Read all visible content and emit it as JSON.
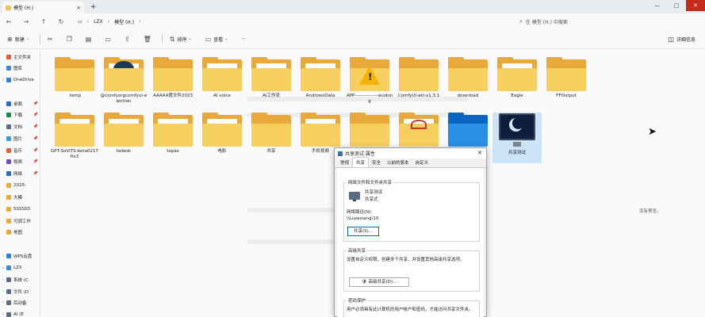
{
  "window": {
    "tab_title": "模型 (H:)",
    "tab_close": "×",
    "new_tab": "+",
    "minimize": "—",
    "maximize": "□",
    "close": "✕"
  },
  "nav": {
    "back": "←",
    "forward": "→",
    "up": "↑",
    "refresh": "↻",
    "breadcrumbs": [
      "LZX",
      "模型 (H:)"
    ],
    "search_placeholder": "在 模型 (H:) 中搜索"
  },
  "toolbar": {
    "new_label": "新建",
    "sort_label": "排序",
    "view_label": "查看",
    "more_label": "···",
    "details_label": "详细信息"
  },
  "sidebar": {
    "items": [
      {
        "label": "主文件夹",
        "color": "#e35b33",
        "expand": ""
      },
      {
        "label": "图库",
        "color": "#3f88d6",
        "expand": ""
      },
      {
        "label": "OneDrive",
        "color": "#2c7fd3",
        "expand": "›"
      },
      {
        "label": "桌面",
        "color": "#2a6bc4",
        "expand": "",
        "pin": "📌"
      },
      {
        "label": "下载",
        "color": "#1f8a4c",
        "expand": "",
        "pin": "📌"
      },
      {
        "label": "文档",
        "color": "#5a6d86",
        "expand": "",
        "pin": "📌"
      },
      {
        "label": "图片",
        "color": "#3c9bd6",
        "expand": "",
        "pin": "📌"
      },
      {
        "label": "音乐",
        "color": "#e0613b",
        "expand": "",
        "pin": "📌"
      },
      {
        "label": "视频",
        "color": "#7a4ac2",
        "expand": "",
        "pin": "📌"
      },
      {
        "label": "网络",
        "color": "#2a6bc4",
        "expand": "",
        "pin": "📌"
      },
      {
        "label": "2025-",
        "color": "#e8a93a",
        "expand": ""
      },
      {
        "label": "大模",
        "color": "#e8a93a",
        "expand": ""
      },
      {
        "label": "SSSSSS",
        "color": "#e8a93a",
        "expand": ""
      },
      {
        "label": "可调工作",
        "color": "#e8a93a",
        "expand": ""
      },
      {
        "label": "地图",
        "color": "#e8a93a",
        "expand": ""
      },
      {
        "label": "WPS云盘",
        "color": "#2c7fd3",
        "expand": "›"
      },
      {
        "label": "LZX",
        "color": "#3f88d6",
        "expand": "⌄"
      },
      {
        "label": "系统 (C",
        "color": "#5a6d86",
        "expand": "›"
      },
      {
        "label": "文件 (D",
        "color": "#5a6d86",
        "expand": "›"
      },
      {
        "label": "后动备",
        "color": "#5a6d86",
        "expand": "›"
      },
      {
        "label": "AI (E",
        "color": "#5a6d86",
        "expand": "›"
      }
    ]
  },
  "files": [
    {
      "name": ".temp",
      "kind": "plain"
    },
    {
      "name": "@comfyorgcomfyui-electron",
      "kind": "logo"
    },
    {
      "name": "AAAAA度文件2023",
      "kind": "plain"
    },
    {
      "name": "AI voice",
      "kind": "paper"
    },
    {
      "name": "AI工作流",
      "kind": "paper"
    },
    {
      "name": "AndrowsData",
      "kind": "paper"
    },
    {
      "name": "APP---------------wudong",
      "kind": "warn"
    },
    {
      "name": "ComfyUI-aki-v1.3.1",
      "kind": "plain"
    },
    {
      "name": "download",
      "kind": "plain"
    },
    {
      "name": "Eagle",
      "kind": "paper"
    },
    {
      "name": "FFOutput",
      "kind": "plain"
    },
    {
      "name": "GPT-SoVITS-beta0217fix3",
      "kind": "paper"
    },
    {
      "name": "todesk",
      "kind": "paper"
    },
    {
      "name": "topaz",
      "kind": "paper"
    },
    {
      "name": "电影",
      "kind": "paper"
    },
    {
      "name": "共享",
      "kind": "plain"
    },
    {
      "name": "手机视频",
      "kind": "paper"
    },
    {
      "name": "",
      "kind": "plain"
    },
    {
      "name": "",
      "kind": "red"
    },
    {
      "name": "",
      "kind": "blue"
    },
    {
      "name": "共享测试",
      "kind": "monitor"
    }
  ],
  "preview": {
    "empty_text": "没有预览。"
  },
  "dialog": {
    "title": "共享测试 属性",
    "close": "✕",
    "tabs": [
      "常规",
      "共享",
      "安全",
      "以前的版本",
      "自定义"
    ],
    "net_group_title": "网络文件和文件夹共享",
    "share_name": "共享测试",
    "share_status": "共享式",
    "net_path_label": "网络路径(N):",
    "net_path": "\\\\Luzexiang\\10",
    "share_button": "共享(S)...",
    "adv_group_title": "高级共享",
    "adv_desc": "设置自定义权限，创建多个共享，并设置其他高级共享选项。",
    "adv_button": "高级共享(D)...",
    "pwd_group_title": "密码保护",
    "pwd_desc": "用户必须具有此计算机的用户帐户和密码，才能访问共享文件夹。"
  }
}
